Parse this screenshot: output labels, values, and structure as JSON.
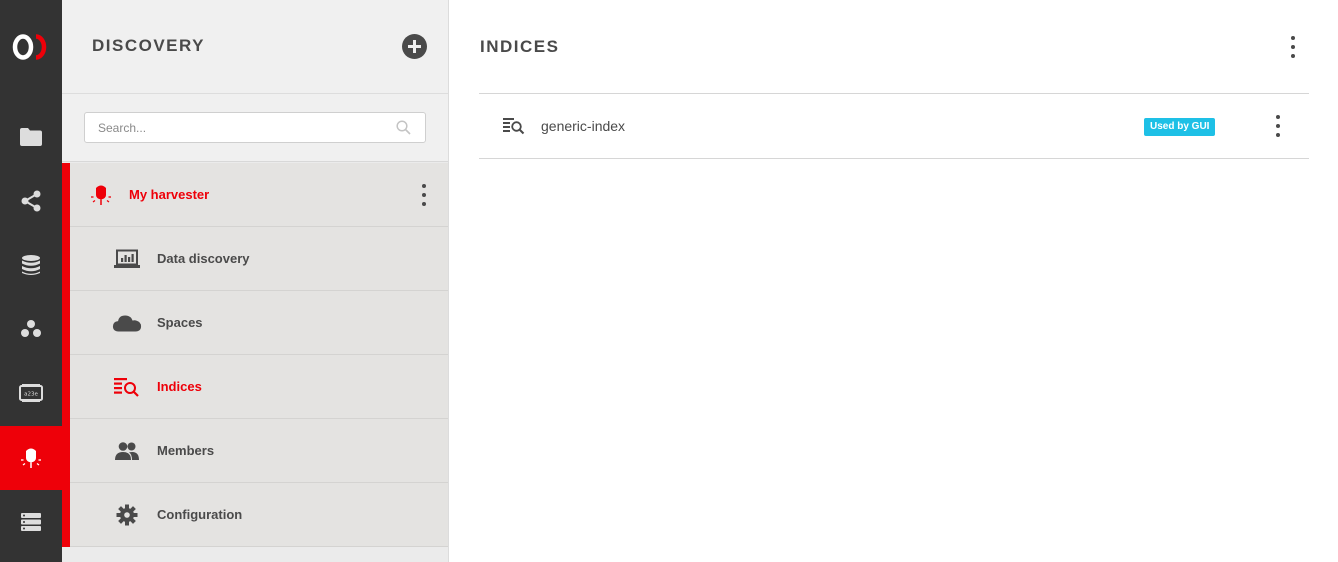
{
  "rail": {
    "logo": {
      "icon": "onedata-logo",
      "color": "#ffffff",
      "accent": "#ee0009"
    },
    "items": [
      {
        "icon": "folder-icon",
        "active": false
      },
      {
        "icon": "share-icon",
        "active": false
      },
      {
        "icon": "database-icon",
        "active": false
      },
      {
        "icon": "groups-icon",
        "active": false
      },
      {
        "icon": "tokens-icon",
        "active": false
      },
      {
        "icon": "harvester-icon",
        "active": true
      },
      {
        "icon": "clusters-icon",
        "active": false
      }
    ],
    "token_icon_text": "a23e"
  },
  "sidebar": {
    "title": "DISCOVERY",
    "search_placeholder": "Search...",
    "harvester": {
      "label": "My harvester",
      "icon": "harvester-icon"
    },
    "items": [
      {
        "label": "Data discovery",
        "icon": "data-discovery-icon",
        "active": false
      },
      {
        "label": "Spaces",
        "icon": "cloud-icon",
        "active": false
      },
      {
        "label": "Indices",
        "icon": "index-icon",
        "active": true
      },
      {
        "label": "Members",
        "icon": "members-icon",
        "active": false
      },
      {
        "label": "Configuration",
        "icon": "gear-icon",
        "active": false
      }
    ]
  },
  "main": {
    "title": "INDICES",
    "indices": [
      {
        "name": "generic-index",
        "badge": "Used by GUI",
        "icon": "index-icon"
      }
    ]
  },
  "colors": {
    "accent": "#ee0009",
    "badge": "#1ec0e6",
    "rail_bg": "#333333",
    "sidebar_bg": "#ebebeb",
    "text": "#4a4a4a"
  }
}
